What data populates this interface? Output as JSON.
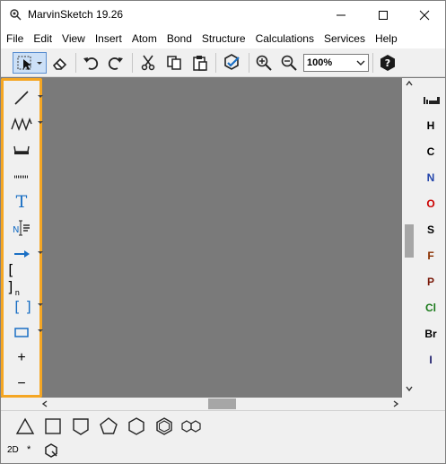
{
  "window": {
    "title": "MarvinSketch 19.26",
    "minimize_glyph": "─",
    "maximize_glyph": "☐",
    "close_glyph": "✕"
  },
  "menu": [
    "File",
    "Edit",
    "View",
    "Insert",
    "Atom",
    "Bond",
    "Structure",
    "Calculations",
    "Services",
    "Help"
  ],
  "toolbar": {
    "zoom_value": "100%",
    "icons": [
      "select-arrow-icon",
      "eraser-icon",
      "undo-icon",
      "redo-icon",
      "cut-icon",
      "copy-icon",
      "paste-icon",
      "clean-icon",
      "zoom-in-icon",
      "zoom-out-icon",
      "help-icon"
    ]
  },
  "left_tools": {
    "text_tool_glyph": "T",
    "bracket_glyph": "[ ]",
    "bracket_subscript": "n",
    "plus_glyph": "+",
    "minus_glyph": "−",
    "accent_color": "#1a6fc4",
    "highlight_color": "#f5a623"
  },
  "atoms": [
    {
      "symbol": "H",
      "color": "#000000"
    },
    {
      "symbol": "C",
      "color": "#000000"
    },
    {
      "symbol": "N",
      "color": "#2244aa"
    },
    {
      "symbol": "O",
      "color": "#cc0000"
    },
    {
      "symbol": "S",
      "color": "#000000"
    },
    {
      "symbol": "F",
      "color": "#8a3000"
    },
    {
      "symbol": "P",
      "color": "#7a1a0a"
    },
    {
      "symbol": "Cl",
      "color": "#1a7a1a"
    },
    {
      "symbol": "Br",
      "color": "#000000"
    },
    {
      "symbol": "I",
      "color": "#1a1a6a"
    }
  ],
  "templates": [
    "triangle-icon",
    "square-icon",
    "pentagon-shield-icon",
    "pentagon-icon",
    "hexagon-icon",
    "benzene-icon",
    "naphthalene-icon"
  ],
  "status": {
    "mode": "2D",
    "star": "*"
  }
}
